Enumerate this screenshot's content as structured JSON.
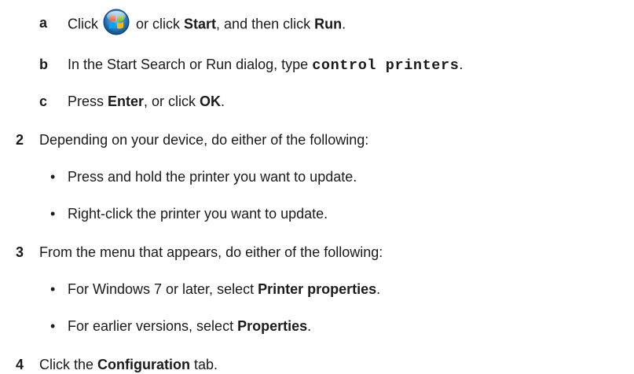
{
  "steps": [
    {
      "marker": "a",
      "parts": {
        "t1": "Click",
        "t2": " or click ",
        "b1": "Start",
        "t3": ", and then click ",
        "b2": "Run",
        "t4": "."
      },
      "icon": "windows-start-orb-icon"
    },
    {
      "marker": "b",
      "parts": {
        "t1": "In the Start Search or Run dialog, type ",
        "code": "control printers",
        "t2": "."
      }
    },
    {
      "marker": "c",
      "parts": {
        "t1": "Press ",
        "b1": "Enter",
        "t2": ", or click ",
        "b2": "OK",
        "t3": "."
      }
    },
    {
      "marker": "2",
      "text": "Depending on your device, do either of the following:",
      "bullets": [
        "Press and hold the printer you want to update.",
        "Right-click the printer you want to update."
      ]
    },
    {
      "marker": "3",
      "text": "From the menu that appears, do either of the following:",
      "bullets": [
        {
          "t1": "For Windows 7 or later, select ",
          "b1": "Printer properties",
          "t2": "."
        },
        {
          "t1": "For earlier versions, select ",
          "b1": "Properties",
          "t2": "."
        }
      ]
    },
    {
      "marker": "4",
      "parts": {
        "t1": "Click the ",
        "b1": "Configuration",
        "t2": " tab."
      }
    }
  ],
  "bullet_symbol": "•"
}
